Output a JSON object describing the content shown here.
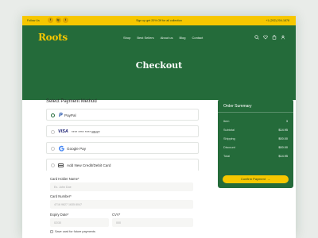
{
  "promo": {
    "follow_label": "Follow Us",
    "socials": [
      "f",
      "ig",
      "t"
    ],
    "offer": "Sign up get 20% Off for all collection",
    "phone": "+1 (202) 204-1878",
    "colors": {
      "bar": "#f6c700"
    }
  },
  "header": {
    "logo": "Roots",
    "nav": [
      "Shop",
      "Best Sellers",
      "About us",
      "Blog",
      "Contact"
    ],
    "icons": [
      "search-icon",
      "heart-icon",
      "bag-icon",
      "user-icon"
    ],
    "title": "Checkout",
    "colors": {
      "brand_green": "#246b3a",
      "accent_yellow": "#f6c700"
    }
  },
  "payment": {
    "title": "Select Payment Method",
    "options": [
      {
        "label": "PayPal",
        "logo_text": "P",
        "selected": true
      },
      {
        "label": "**** **** **** 8047",
        "logo_text": "VISA",
        "selected": false
      },
      {
        "label": "Google Pay",
        "logo_text": "G",
        "selected": false
      },
      {
        "label": "Add New Credit/Debit Card",
        "logo_text": "",
        "selected": false
      }
    ],
    "form": {
      "holder_label": "Card Holder Name*",
      "holder_placeholder": "Ex. John Doe",
      "number_label": "Card Number*",
      "number_placeholder": "4716 9627 1635 8047",
      "expiry_label": "Expiry Date*",
      "expiry_placeholder": "02/30",
      "cvv_label": "CVV*",
      "cvv_placeholder": "000",
      "save_label": "Save card for future payments"
    }
  },
  "summary": {
    "title": "Order Summary",
    "rows": [
      {
        "k": "Item",
        "v": "3"
      },
      {
        "k": "Subtotal",
        "v": "$14.95"
      },
      {
        "k": "Shipping",
        "v": "$00.00"
      },
      {
        "k": "Discount",
        "v": "$00.00"
      },
      {
        "k": "Total",
        "v": "$14.95"
      }
    ],
    "confirm_label": "Confirm Payment",
    "confirm_arrow": "→"
  }
}
